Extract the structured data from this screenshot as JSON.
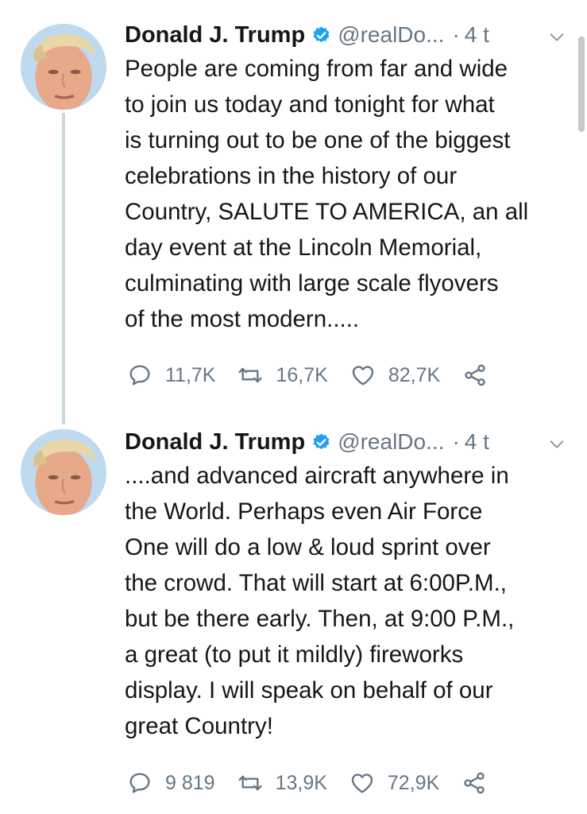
{
  "tweets": [
    {
      "author_name": "Donald J. Trump",
      "handle": "@realDo...",
      "separator": "·",
      "time": "4 t",
      "body_lines": [
        "People are coming from far and wide",
        "to join us today and tonight for what",
        "is turning out to be one of the biggest",
        "celebrations in the history of our",
        "Country, SALUTE TO AMERICA, an all",
        "day event at the Lincoln Memorial,",
        "culminating with large scale flyovers",
        "of the most modern....."
      ],
      "replies": "11,7K",
      "retweets": "16,7K",
      "likes": "82,7K"
    },
    {
      "author_name": "Donald J. Trump",
      "handle": "@realDo...",
      "separator": "·",
      "time": "4 t",
      "body_lines": [
        "....and advanced aircraft anywhere in",
        "the World. Perhaps even Air Force",
        "One will do a low & loud sprint over",
        "the crowd. That will start at 6:00P.M.,",
        "but be there early. Then, at 9:00 P.M.,",
        "a great (to put it mildly) fireworks",
        "display. I will speak on behalf of our",
        "great Country!"
      ],
      "replies": "9 819",
      "retweets": "13,9K",
      "likes": "72,9K"
    }
  ],
  "icons": {
    "verified": "verified-badge-icon",
    "caret": "chevron-down-icon",
    "reply": "reply-bubble-icon",
    "retweet": "retweet-icon",
    "like": "heart-icon",
    "share": "share-icon"
  },
  "colors": {
    "text": "#14171a",
    "secondary": "#657786",
    "verified": "#1da1f2",
    "thread_line": "#ccd6dd"
  }
}
